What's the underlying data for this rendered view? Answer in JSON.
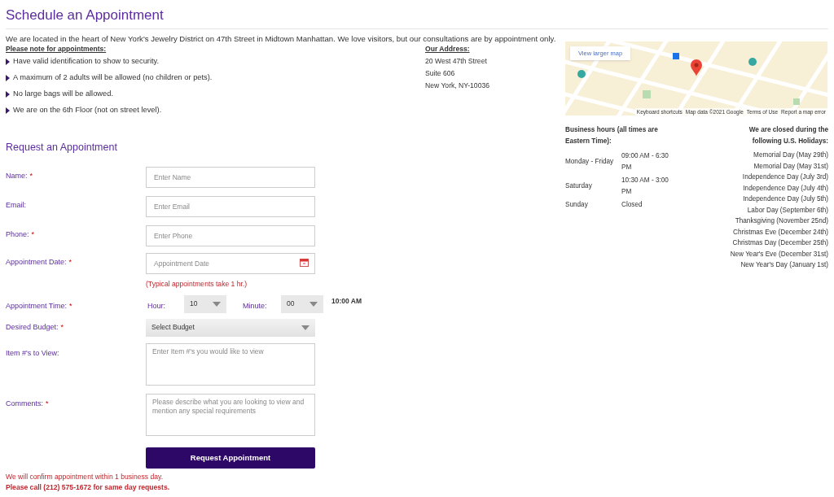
{
  "title": "Schedule an Appointment",
  "intro": "We are located in the heart of New York's Jewelry District on 47th Street in Midtown Manhattan. We love visitors, but our consultations are by appointment only.",
  "notes": {
    "heading": "Please note for appointments:",
    "items": [
      "Have valid identification to show to security.",
      "A maximum of 2 adults will be allowed (no children or pets).",
      "No large bags will be allowed.",
      "We are on the 6th Floor (not on street level)."
    ]
  },
  "address": {
    "heading": "Our Address:",
    "lines": [
      "20 West 47th Street",
      "Suite 606",
      "New York, NY-10036"
    ]
  },
  "map": {
    "kind": "picture",
    "link": "View larger map",
    "footer": [
      "Keyboard shortcuts",
      "Map data ©2021 Google",
      "Terms of Use",
      "Report a map error"
    ]
  },
  "hours": {
    "heading": "Business hours (all times are Eastern Time):",
    "rows": [
      {
        "day": "Monday - Friday",
        "time": "09:00 AM - 6:30 PM"
      },
      {
        "day": "Saturday",
        "time": "10:30 AM - 3:00 PM"
      },
      {
        "day": "Sunday",
        "time": "Closed"
      }
    ]
  },
  "holidays": {
    "heading": "We are closed during the following U.S. Holidays:",
    "items": [
      "Memorial Day (May 29th)",
      "Memorial Day (May 31st)",
      "Independence Day (July 3rd)",
      "Independence Day (July 4th)",
      "Independence Day (July 5th)",
      "Labor Day (September 6th)",
      "Thanksgiving (November 25nd)",
      "Christmas Eve (December 24th)",
      "Christmas Day (December 25th)",
      "New Year's Eve (December 31st)",
      "New Year's Day (January 1st)"
    ]
  },
  "form": {
    "heading": "Request an Appointment",
    "fields": [
      {
        "kind": "input",
        "label": "Name:",
        "required": true,
        "placeholder": "Enter Name"
      },
      {
        "kind": "input",
        "label": "Email:",
        "required": false,
        "placeholder": "Enter Email"
      },
      {
        "kind": "input",
        "label": "Phone:",
        "required": true,
        "placeholder": "Enter Phone"
      },
      {
        "kind": "date",
        "label": "Appointment Date:",
        "required": true,
        "placeholder": "Appointment Date",
        "hint": "(Typical appointments take 1 hr.)"
      },
      {
        "kind": "time",
        "label": "Appointment Time:",
        "required": true,
        "hour_label": "Hour:",
        "hour": "10",
        "minute_label": "Minute:",
        "minute": "00",
        "display": "10:00 AM"
      },
      {
        "kind": "select",
        "label": "Desired Budget:",
        "required": true,
        "value": "Select Budget"
      },
      {
        "kind": "textarea",
        "label": "Item #'s to View:",
        "required": false,
        "placeholder": "Enter Item #'s you would like to view"
      },
      {
        "kind": "textarea",
        "label": "Comments:",
        "required": true,
        "placeholder": "Please describe what you are looking to view and mention any special requirements"
      }
    ],
    "required_mark": "*",
    "submit": "Request Appointment",
    "confirm": "We will confirm appointment within 1 business day.",
    "call": "Please call (212) 575-1672 for same day requests."
  }
}
